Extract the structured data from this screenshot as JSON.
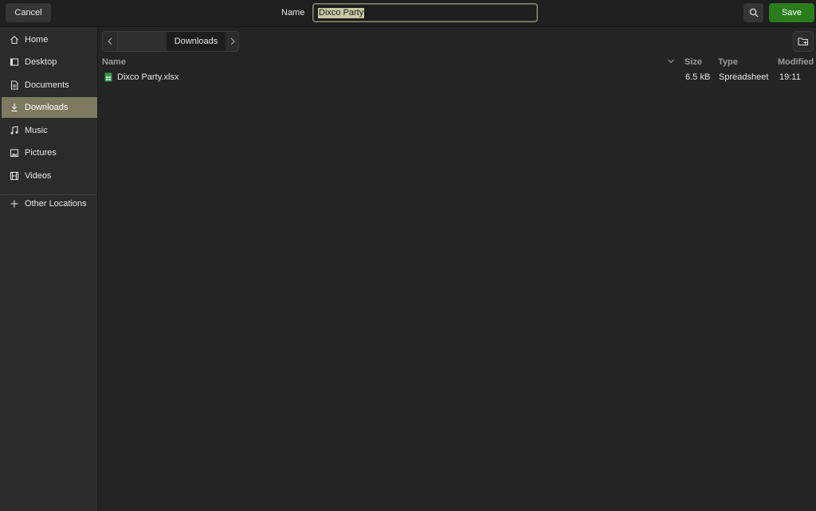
{
  "header": {
    "cancel_label": "Cancel",
    "name_label": "Name",
    "name_value": "Dixco Party",
    "save_label": "Save"
  },
  "sidebar": {
    "items": [
      {
        "label": "Home",
        "icon": "home-icon"
      },
      {
        "label": "Desktop",
        "icon": "desktop-icon"
      },
      {
        "label": "Documents",
        "icon": "documents-icon"
      },
      {
        "label": "Downloads",
        "icon": "downloads-icon",
        "active": true
      },
      {
        "label": "Music",
        "icon": "music-icon"
      },
      {
        "label": "Pictures",
        "icon": "pictures-icon"
      },
      {
        "label": "Videos",
        "icon": "videos-icon"
      },
      {
        "label": "Other Locations",
        "icon": "plus-icon"
      }
    ]
  },
  "pathbar": {
    "current": "Downloads"
  },
  "columns": {
    "name": "Name",
    "size": "Size",
    "type": "Type",
    "modified": "Modified"
  },
  "files": [
    {
      "name": "Dixco Party.xlsx",
      "size": "6.5 kB",
      "type": "Spreadsheet",
      "modified": "19:11",
      "icon": "spreadsheet-icon"
    }
  ],
  "colors": {
    "accent_save": "#2b7d1c",
    "selection": "#7d7a5f"
  }
}
